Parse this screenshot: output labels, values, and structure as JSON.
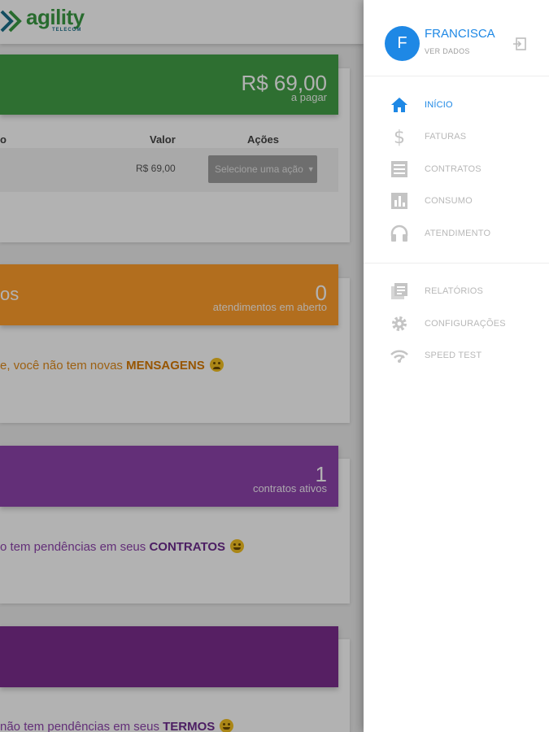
{
  "header": {
    "logo_word": "agility",
    "logo_sub": "TELECOM"
  },
  "invoices_card": {
    "amount": "R$ 69,00",
    "amount_caption": "a pagar",
    "col_partial": "o",
    "col_value": "Valor",
    "col_actions": "Ações",
    "row_value": "R$ 69,00",
    "select_placeholder": "Selecione uma ação"
  },
  "tickets_card": {
    "title_partial": "os",
    "count": "0",
    "caption": "atendimentos em aberto",
    "message_prefix": "e, você não tem novas ",
    "message_bold": "MENSAGENS"
  },
  "contracts_card": {
    "count": "1",
    "caption": "contratos ativos",
    "message_prefix": "o tem pendências em seus ",
    "message_bold": "CONTRATOS"
  },
  "terms_card": {
    "message_prefix": "não tem pendências em seus ",
    "message_bold": "TERMOS"
  },
  "drawer": {
    "avatar_letter": "F",
    "user_name": "FRANCISCA",
    "user_link": "VER DADOS",
    "primary_items": [
      {
        "label": "INÍCIO",
        "icon": "home-icon",
        "active": true
      },
      {
        "label": "FATURAS",
        "icon": "dollar-icon"
      },
      {
        "label": "CONTRATOS",
        "icon": "document-icon"
      },
      {
        "label": "CONSUMO",
        "icon": "bar-chart-icon"
      },
      {
        "label": "ATENDIMENTO",
        "icon": "headset-icon"
      }
    ],
    "secondary_items": [
      {
        "label": "RELATÓRIOS",
        "icon": "report-icon"
      },
      {
        "label": "CONFIGURAÇÕES",
        "icon": "gear-icon"
      },
      {
        "label": "SPEED TEST",
        "icon": "wifi-icon"
      }
    ]
  },
  "colors": {
    "primary_blue": "#1e88e5",
    "green": "#43a047",
    "orange": "#ff9e2c",
    "purple": "#8e44ad",
    "dark_purple": "#7b2d8e"
  }
}
